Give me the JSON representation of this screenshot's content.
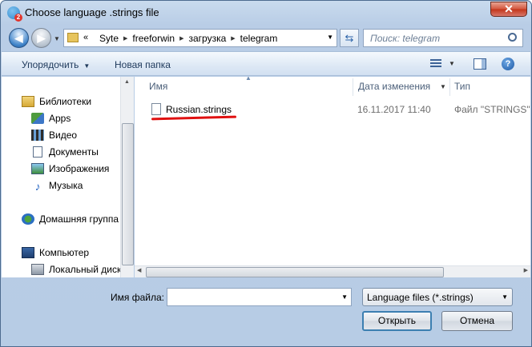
{
  "window": {
    "title": "Choose language .strings file",
    "close_glyph": "✕",
    "app_badge": "2"
  },
  "nav": {
    "back_glyph": "◀",
    "forward_glyph": "▶"
  },
  "address": {
    "overflow": "«",
    "crumbs": [
      "Syte",
      "freeforwin",
      "загрузка",
      "telegram"
    ]
  },
  "search": {
    "placeholder": "Поиск: telegram"
  },
  "toolbar": {
    "organize_label": "Упорядочить",
    "new_folder_label": "Новая папка",
    "help_glyph": "?"
  },
  "navpane": {
    "items": [
      {
        "label": "Библиотеки",
        "icon": "libraries-icon"
      },
      {
        "label": "Apps",
        "icon": "apps-icon"
      },
      {
        "label": "Видео",
        "icon": "video-icon"
      },
      {
        "label": "Документы",
        "icon": "documents-icon"
      },
      {
        "label": "Изображения",
        "icon": "images-icon"
      },
      {
        "label": "Музыка",
        "icon": "music-icon"
      },
      {
        "label": "Домашняя группа",
        "icon": "homegroup-icon"
      },
      {
        "label": "Компьютер",
        "icon": "computer-icon"
      },
      {
        "label": "Локальный диск",
        "icon": "disk-icon"
      }
    ]
  },
  "filelist": {
    "columns": {
      "name": "Имя",
      "date": "Дата изменения",
      "type": "Тип"
    },
    "rows": [
      {
        "name": "Russian.strings",
        "date": "16.11.2017 11:40",
        "type": "Файл \"STRINGS\""
      }
    ]
  },
  "footer": {
    "filename_label": "Имя файла:",
    "filename_value": "",
    "filter_value": "Language files (*.strings)",
    "open_label": "Открыть",
    "cancel_label": "Отмена"
  },
  "colors": {
    "annotation": "#e01010",
    "accent": "#3c7fb1"
  }
}
